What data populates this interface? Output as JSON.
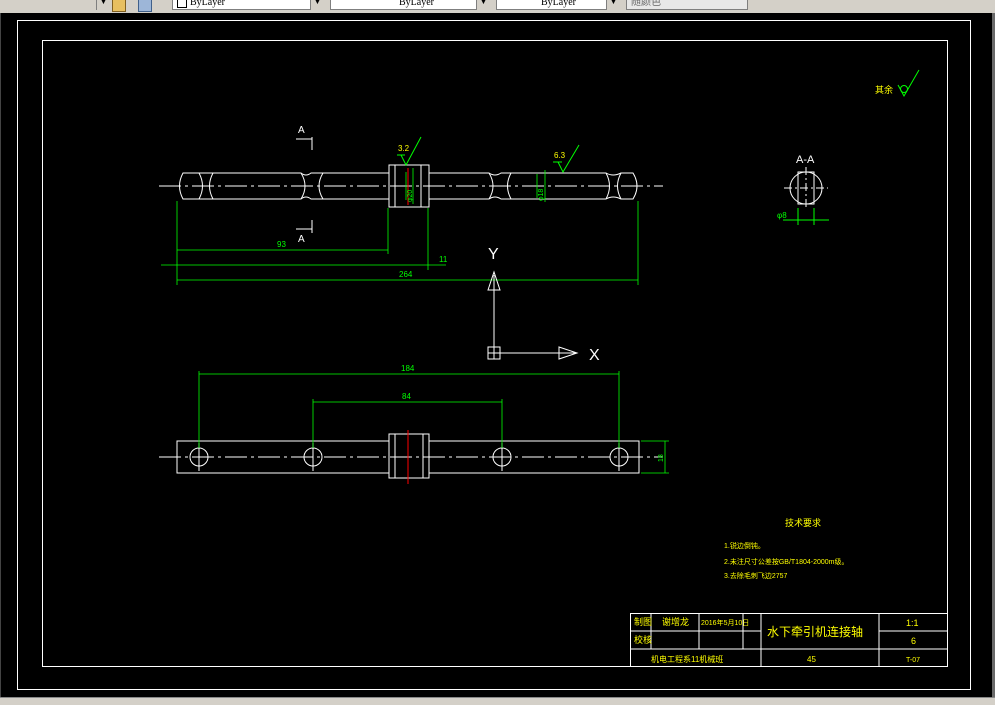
{
  "toolbar": {
    "layer_color": "ByLayer",
    "linetype": "ByLayer",
    "lineweight": "ByLayer",
    "plot_style": "随颜色",
    "icons": [
      "layer-state-icon",
      "layer-previous-icon"
    ]
  },
  "drawing": {
    "section_label": "A-A",
    "cut_label_top": "A",
    "cut_label_bottom": "A",
    "roughness_1": "3.2",
    "roughness_2": "6.3",
    "roughness_note": "其余",
    "dim_93": "93",
    "dim_11": "11",
    "dim_264": "264",
    "dim_184": "184",
    "dim_84": "84",
    "dim_diam_8": "φ8",
    "dim_diam_a": "φ20",
    "dim_diam_b": "φ18",
    "dim_thick": "18",
    "ucs_x": "X",
    "ucs_y": "Y"
  },
  "tech": {
    "title": "技术要求",
    "line1": "1.锐边倒钝。",
    "line2": "2.未注尺寸公差按GB/T1804-2000m级。",
    "line3": "3.去除毛刺飞边2757"
  },
  "title_block": {
    "drawn_label": "制图",
    "drawn_by": "谢增龙",
    "date": "2016年5月10日",
    "checked_label": "校核",
    "part_name": "水下牵引机连接轴",
    "scale": "1:1",
    "qty": "6",
    "school": "机电工程系11机械班",
    "material": "45",
    "drawing_no": "T-07"
  },
  "colors": {
    "background": "#000000",
    "geometry": "#ffffff",
    "dimension": "#00ff00",
    "text": "#ffff00",
    "center_mark": "#ff0000"
  }
}
